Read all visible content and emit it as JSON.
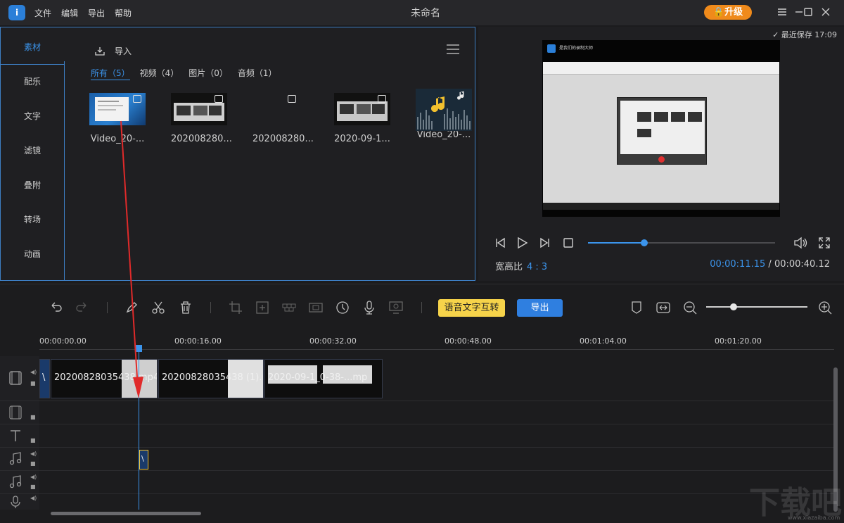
{
  "app": {
    "logo": "i",
    "title": "未命名",
    "menu": [
      "文件",
      "编辑",
      "导出",
      "帮助"
    ],
    "upgrade_label": "升级",
    "window_controls": [
      "menu-icon",
      "minimize-icon",
      "maximize-icon",
      "close-icon"
    ]
  },
  "sidebar": {
    "tabs": [
      "素材",
      "配乐",
      "文字",
      "滤镜",
      "叠附",
      "转场",
      "动画"
    ],
    "active": 0
  },
  "library": {
    "import_label": "导入",
    "filters": [
      "所有（5）",
      "视频（4）",
      "图片（0）",
      "音频（1）"
    ],
    "active_filter": 0,
    "items": [
      {
        "name": "Video_20-...",
        "type": "video"
      },
      {
        "name": "202008280...",
        "type": "video"
      },
      {
        "name": "202008280...",
        "type": "video"
      },
      {
        "name": "2020-09-1...",
        "type": "video"
      },
      {
        "name": "Video_20-...",
        "type": "audio"
      }
    ]
  },
  "preview": {
    "last_saved": "最近保存 17:09",
    "aspect_label": "宽高比",
    "aspect_value": "4 : 3",
    "current_time": "00:00:11.15",
    "time_separator": "/",
    "total_time": "00:00:40.12",
    "progress": 0.3,
    "screen_caption": "是我们的录制大师"
  },
  "timeline": {
    "voice_text_button": "语音文字互转",
    "export_button": "导出",
    "zoom_level": 0.27,
    "ruler_ticks": [
      "00:00:00.00",
      "00:00:16.00",
      "00:00:32.00",
      "00:00:48.00",
      "00:01:04.00",
      "00:01:20.00"
    ],
    "clips": [
      {
        "label": "\\"
      },
      {
        "label": "20200828035438.mp4"
      },
      {
        "label": "20200828035438 (1).m"
      },
      {
        "label": "2020-09-1_0-38-...mp"
      }
    ],
    "audio_clip_label": "\\",
    "tracks": [
      "video-track",
      "overlay-track",
      "text-track",
      "music-track",
      "music-track-2",
      "voice-track"
    ]
  },
  "watermark": {
    "text": "下载吧",
    "url": "www.xiazaiba.com"
  },
  "colors": {
    "accent": "#3b94ec",
    "upgrade": "#ef8a1b",
    "voice_button": "#f6d34a",
    "export_button": "#2f7fe0",
    "annotation_arrow": "#e02a2a"
  }
}
